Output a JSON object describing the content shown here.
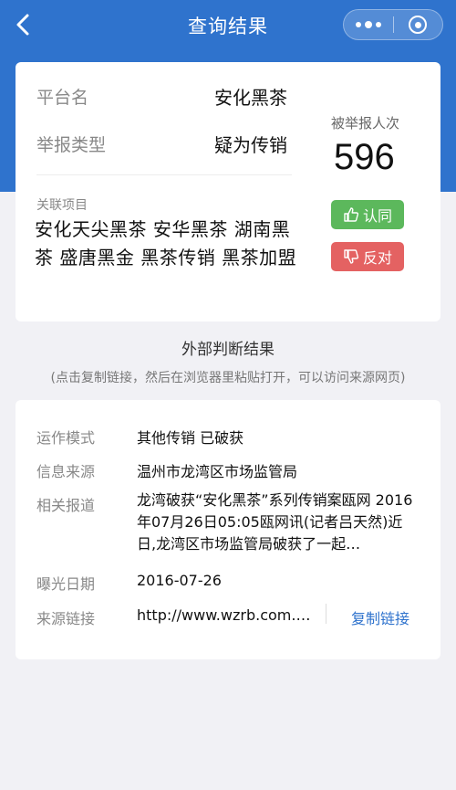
{
  "nav": {
    "title": "查询结果"
  },
  "summary": {
    "platform_label": "平台名",
    "platform_value": "安化黑茶",
    "type_label": "举报类型",
    "type_value": "疑为传销",
    "count_label": "被举报人次",
    "count_value": "596",
    "related_label": "关联项目",
    "related_text": "安化天尖黑茶  安华黑茶  湖南黑茶  盛唐黑金  黑茶传销  黑茶加盟",
    "agree_label": "认同",
    "oppose_label": "反对"
  },
  "external": {
    "title": "外部判断结果",
    "hint": "(点击复制链接，然后在浏览器里粘贴打开，可以访问来源网页)",
    "mode_label": "运作模式",
    "mode_value": "其他传销 已破获",
    "source_label": "信息来源",
    "source_value": "温州市龙湾区市场监管局",
    "report_label": "相关报道",
    "report_value": "龙湾破获“安化黑茶”系列传销案瓯网  2016年07月26日05:05瓯网讯(记者吕天然)近日,龙湾区市场监管局破获了一起…",
    "date_label": "曝光日期",
    "date_value": "2016-07-26",
    "link_label": "来源链接",
    "link_value": "http://www.wzrb.com.…",
    "copy_label": "复制链接"
  },
  "colors": {
    "brand": "#2f73cd",
    "agree": "#5cb85c",
    "oppose": "#e46262"
  }
}
